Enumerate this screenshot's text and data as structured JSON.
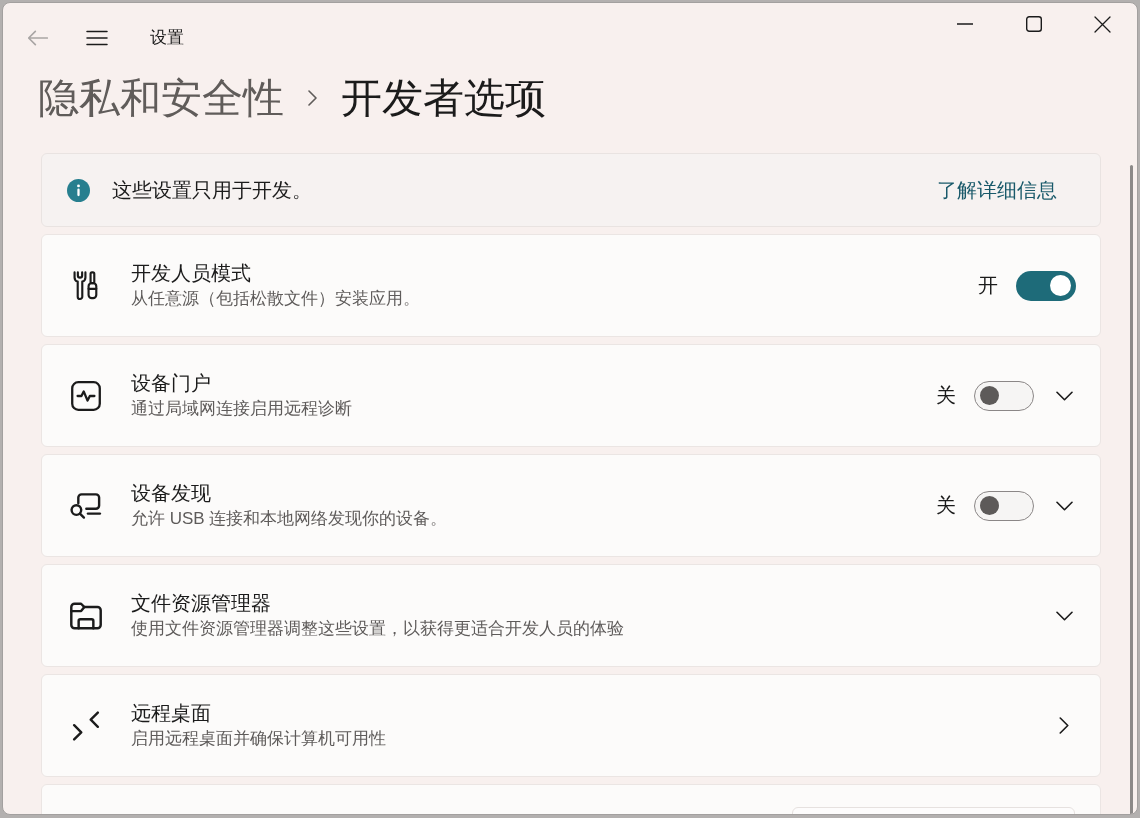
{
  "title_bar": {
    "title": "设置",
    "back_disabled": true
  },
  "breadcrumb": [
    {
      "label": "隐私和安全性",
      "current": false
    },
    {
      "label": "开发者选项",
      "current": true
    }
  ],
  "info_bar": {
    "text": "这些设置只用于开发。",
    "link": "了解详细信息"
  },
  "settings": [
    {
      "kind": "toggle",
      "title": "开发人员模式",
      "description": "从任意源（包括松散文件）安装应用。",
      "on": true,
      "state_label": "开"
    },
    {
      "kind": "toggle_expander",
      "title": "设备门户",
      "description": "通过局域网连接启用远程诊断",
      "on": false,
      "state_label": "关",
      "expanded": false
    },
    {
      "kind": "toggle_expander",
      "title": "设备发现",
      "description": "允许 USB 连接和本地网络发现你的设备。",
      "on": false,
      "state_label": "关",
      "expanded": false
    },
    {
      "kind": "expander",
      "title": "文件资源管理器",
      "description": "使用文件资源管理器调整这些设置，以获得更适合开发人员的体验",
      "expanded": false
    },
    {
      "kind": "link",
      "title": "远程桌面",
      "description": "启用远程桌面并确保计算机可用性"
    },
    {
      "kind": "dropdown"
    }
  ]
}
